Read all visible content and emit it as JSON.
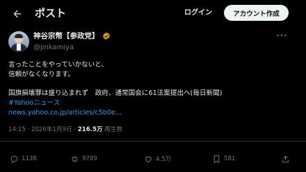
{
  "header": {
    "title": "ポスト",
    "login_label": "ログイン",
    "create_account_label": "アカウント作成"
  },
  "author": {
    "name": "神谷宗幣【参政党】",
    "handle": "@jinkamiya"
  },
  "post": {
    "line1": "言ったことをやっていかないと、",
    "line2": "信頼がなくなります。",
    "line3": "国旗損壊罪は盛り込まれず　政府、通常国会に61法案提出へ(毎日新聞)",
    "hashtag": "#Yahooニュース",
    "link": "news.yahoo.co.jp/articles/c5b0e..."
  },
  "meta": {
    "time": "14:15",
    "date": "2026年1月9日",
    "views": "216.5万",
    "views_label": "再生数"
  },
  "actions": {
    "replies": "1138",
    "reposts": "9789",
    "likes": "4.5万",
    "bookmarks": "581"
  },
  "colors": {
    "background": "#000000",
    "text": "#e7e9ea",
    "muted": "#71767b",
    "accent": "#1d9bf0",
    "badge": "#d4a017"
  }
}
